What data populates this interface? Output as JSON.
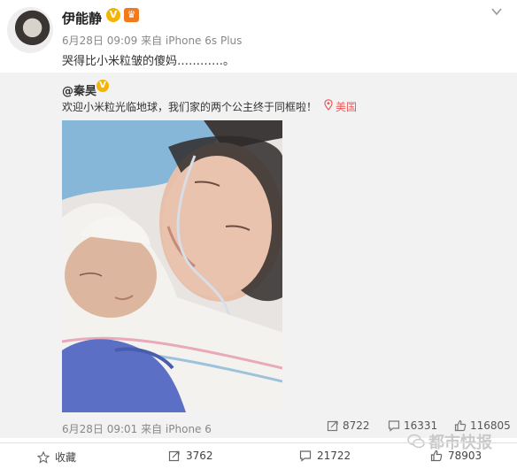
{
  "post": {
    "username": "伊能静",
    "verified_badge": "V",
    "meta": "6月28日 09:09 来自 iPhone 6s Plus",
    "text": "哭得比小米粒皱的傻妈…………。"
  },
  "repost": {
    "username": "@秦昊",
    "verified_badge": "V",
    "text": "欢迎小米粒光临地球，我们家的两个公主终于同框啦！",
    "location": "美国",
    "meta": "6月28日 09:01 来自 iPhone 6",
    "stats": {
      "reposts": "8722",
      "comments": "16331",
      "likes": "116805"
    }
  },
  "actions": {
    "favorite_label": "收藏",
    "repost_count": "3762",
    "comment_count": "21722",
    "like_count": "78903"
  },
  "watermark": "都市快报",
  "icons": [
    "chevron-down-icon",
    "location-icon",
    "repost-icon",
    "comment-icon",
    "like-icon",
    "star-icon",
    "wechat-icon"
  ],
  "colors": {
    "verified": "#f4b400",
    "location": "#e85a5a",
    "repost_bg": "#f2f2f2"
  }
}
